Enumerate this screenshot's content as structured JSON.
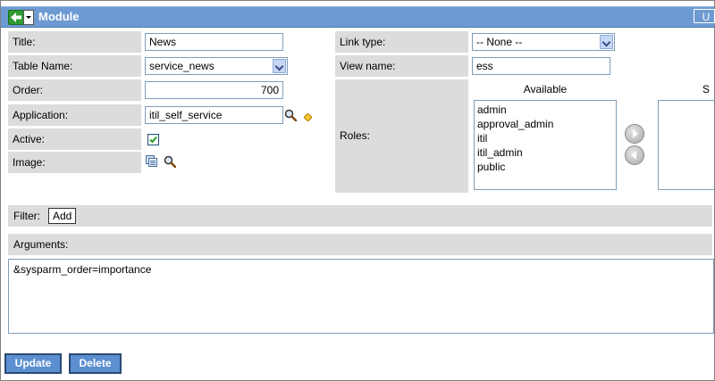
{
  "header": {
    "title": "Module",
    "update_label": "U"
  },
  "form": {
    "title_label": "Title:",
    "title_value": "News",
    "table_name_label": "Table Name:",
    "table_name_value": "service_news",
    "order_label": "Order:",
    "order_value": "700",
    "application_label": "Application:",
    "application_value": "itil_self_service",
    "active_label": "Active:",
    "image_label": "Image:",
    "link_type_label": "Link type:",
    "link_type_value": "-- None --",
    "view_name_label": "View name:",
    "view_name_value": "ess",
    "roles_label": "Roles:",
    "available_label": "Available",
    "selected_label": "S",
    "available_roles": [
      "admin",
      "approval_admin",
      "itil",
      "itil_admin",
      "public"
    ],
    "filter_label": "Filter:",
    "add_label": "Add",
    "arguments_label": "Arguments:",
    "arguments_value": "&sysparm_order=importance"
  },
  "actions": {
    "update_label": "Update",
    "delete_label": "Delete"
  },
  "colors": {
    "header": "#6d9ad2",
    "label_bg": "#dcdcdc",
    "button": "#5b8fd0"
  }
}
